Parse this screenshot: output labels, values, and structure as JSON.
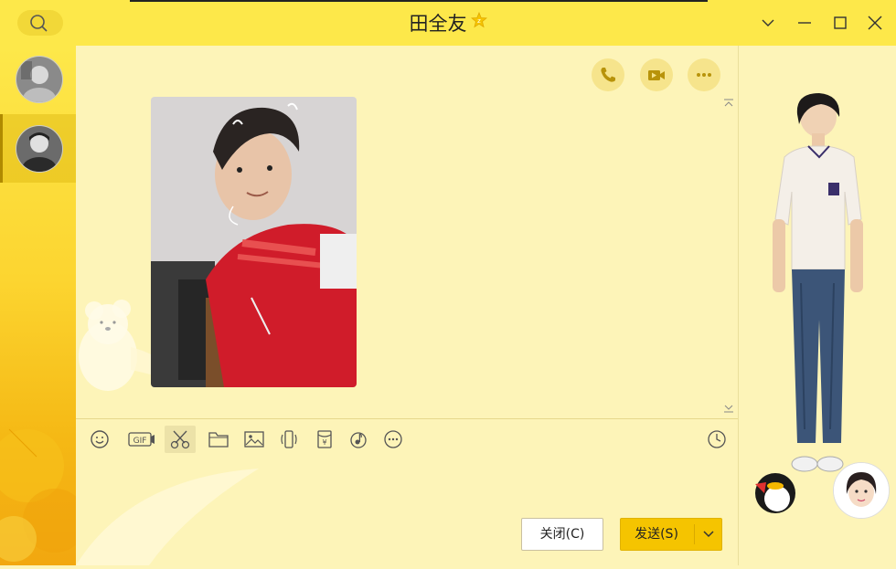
{
  "window": {
    "title": "田全友",
    "badge_icon": "vip-star-icon"
  },
  "header": {
    "search_icon": "search-icon",
    "controls": [
      "chevron-down-icon",
      "minimize-icon",
      "maximize-icon",
      "close-icon"
    ]
  },
  "sidebar": {
    "contacts": [
      {
        "name": "contact-1",
        "selected": false
      },
      {
        "name": "contact-2",
        "selected": true
      }
    ]
  },
  "chat_actions": [
    "phone-icon",
    "video-icon",
    "more-icon"
  ],
  "toolbar": {
    "items": [
      "emoji-icon",
      "gif-icon",
      "scissors-icon",
      "folder-icon",
      "image-icon",
      "shake-icon",
      "red-packet-icon",
      "music-icon",
      "more-icon"
    ],
    "gif_label": "GIF",
    "history_icon": "clock-icon"
  },
  "buttons": {
    "close_label": "关闭(C)",
    "send_label": "发送(S)"
  },
  "colors": {
    "title_bar": "#fde84a",
    "background": "#fdf4b8",
    "send_button": "#f5c400"
  }
}
